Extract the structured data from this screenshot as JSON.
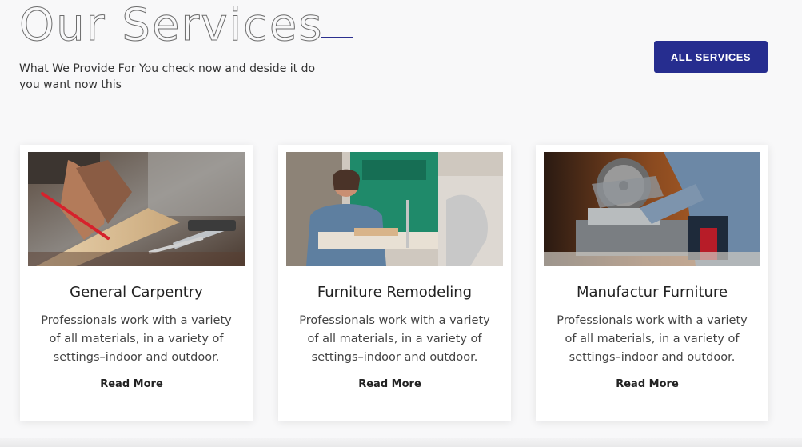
{
  "header": {
    "title": "Our Services",
    "subtitle": "What We Provide For You check now and deside it do you want now this",
    "cta_label": "ALL SERVICES"
  },
  "cards": [
    {
      "title": "General Carpentry",
      "text": "Professionals work with a variety of all materials, in a variety of settings–indoor and outdoor.",
      "link": "Read More",
      "image_alt": "carpenter-marking-wood-image"
    },
    {
      "title": "Furniture Remodeling",
      "text": "Professionals work with a variety of all materials, in a variety of settings–indoor and outdoor.",
      "link": "Read More",
      "image_alt": "woman-at-bandsaw-image"
    },
    {
      "title": "Manufactur Furniture",
      "text": "Professionals work with a variety of all materials, in a variety of settings–indoor and outdoor.",
      "link": "Read More",
      "image_alt": "miter-saw-cutting-image"
    }
  ],
  "colors": {
    "accent": "#262d8f",
    "background": "#f8f8f9",
    "card": "#ffffff"
  }
}
